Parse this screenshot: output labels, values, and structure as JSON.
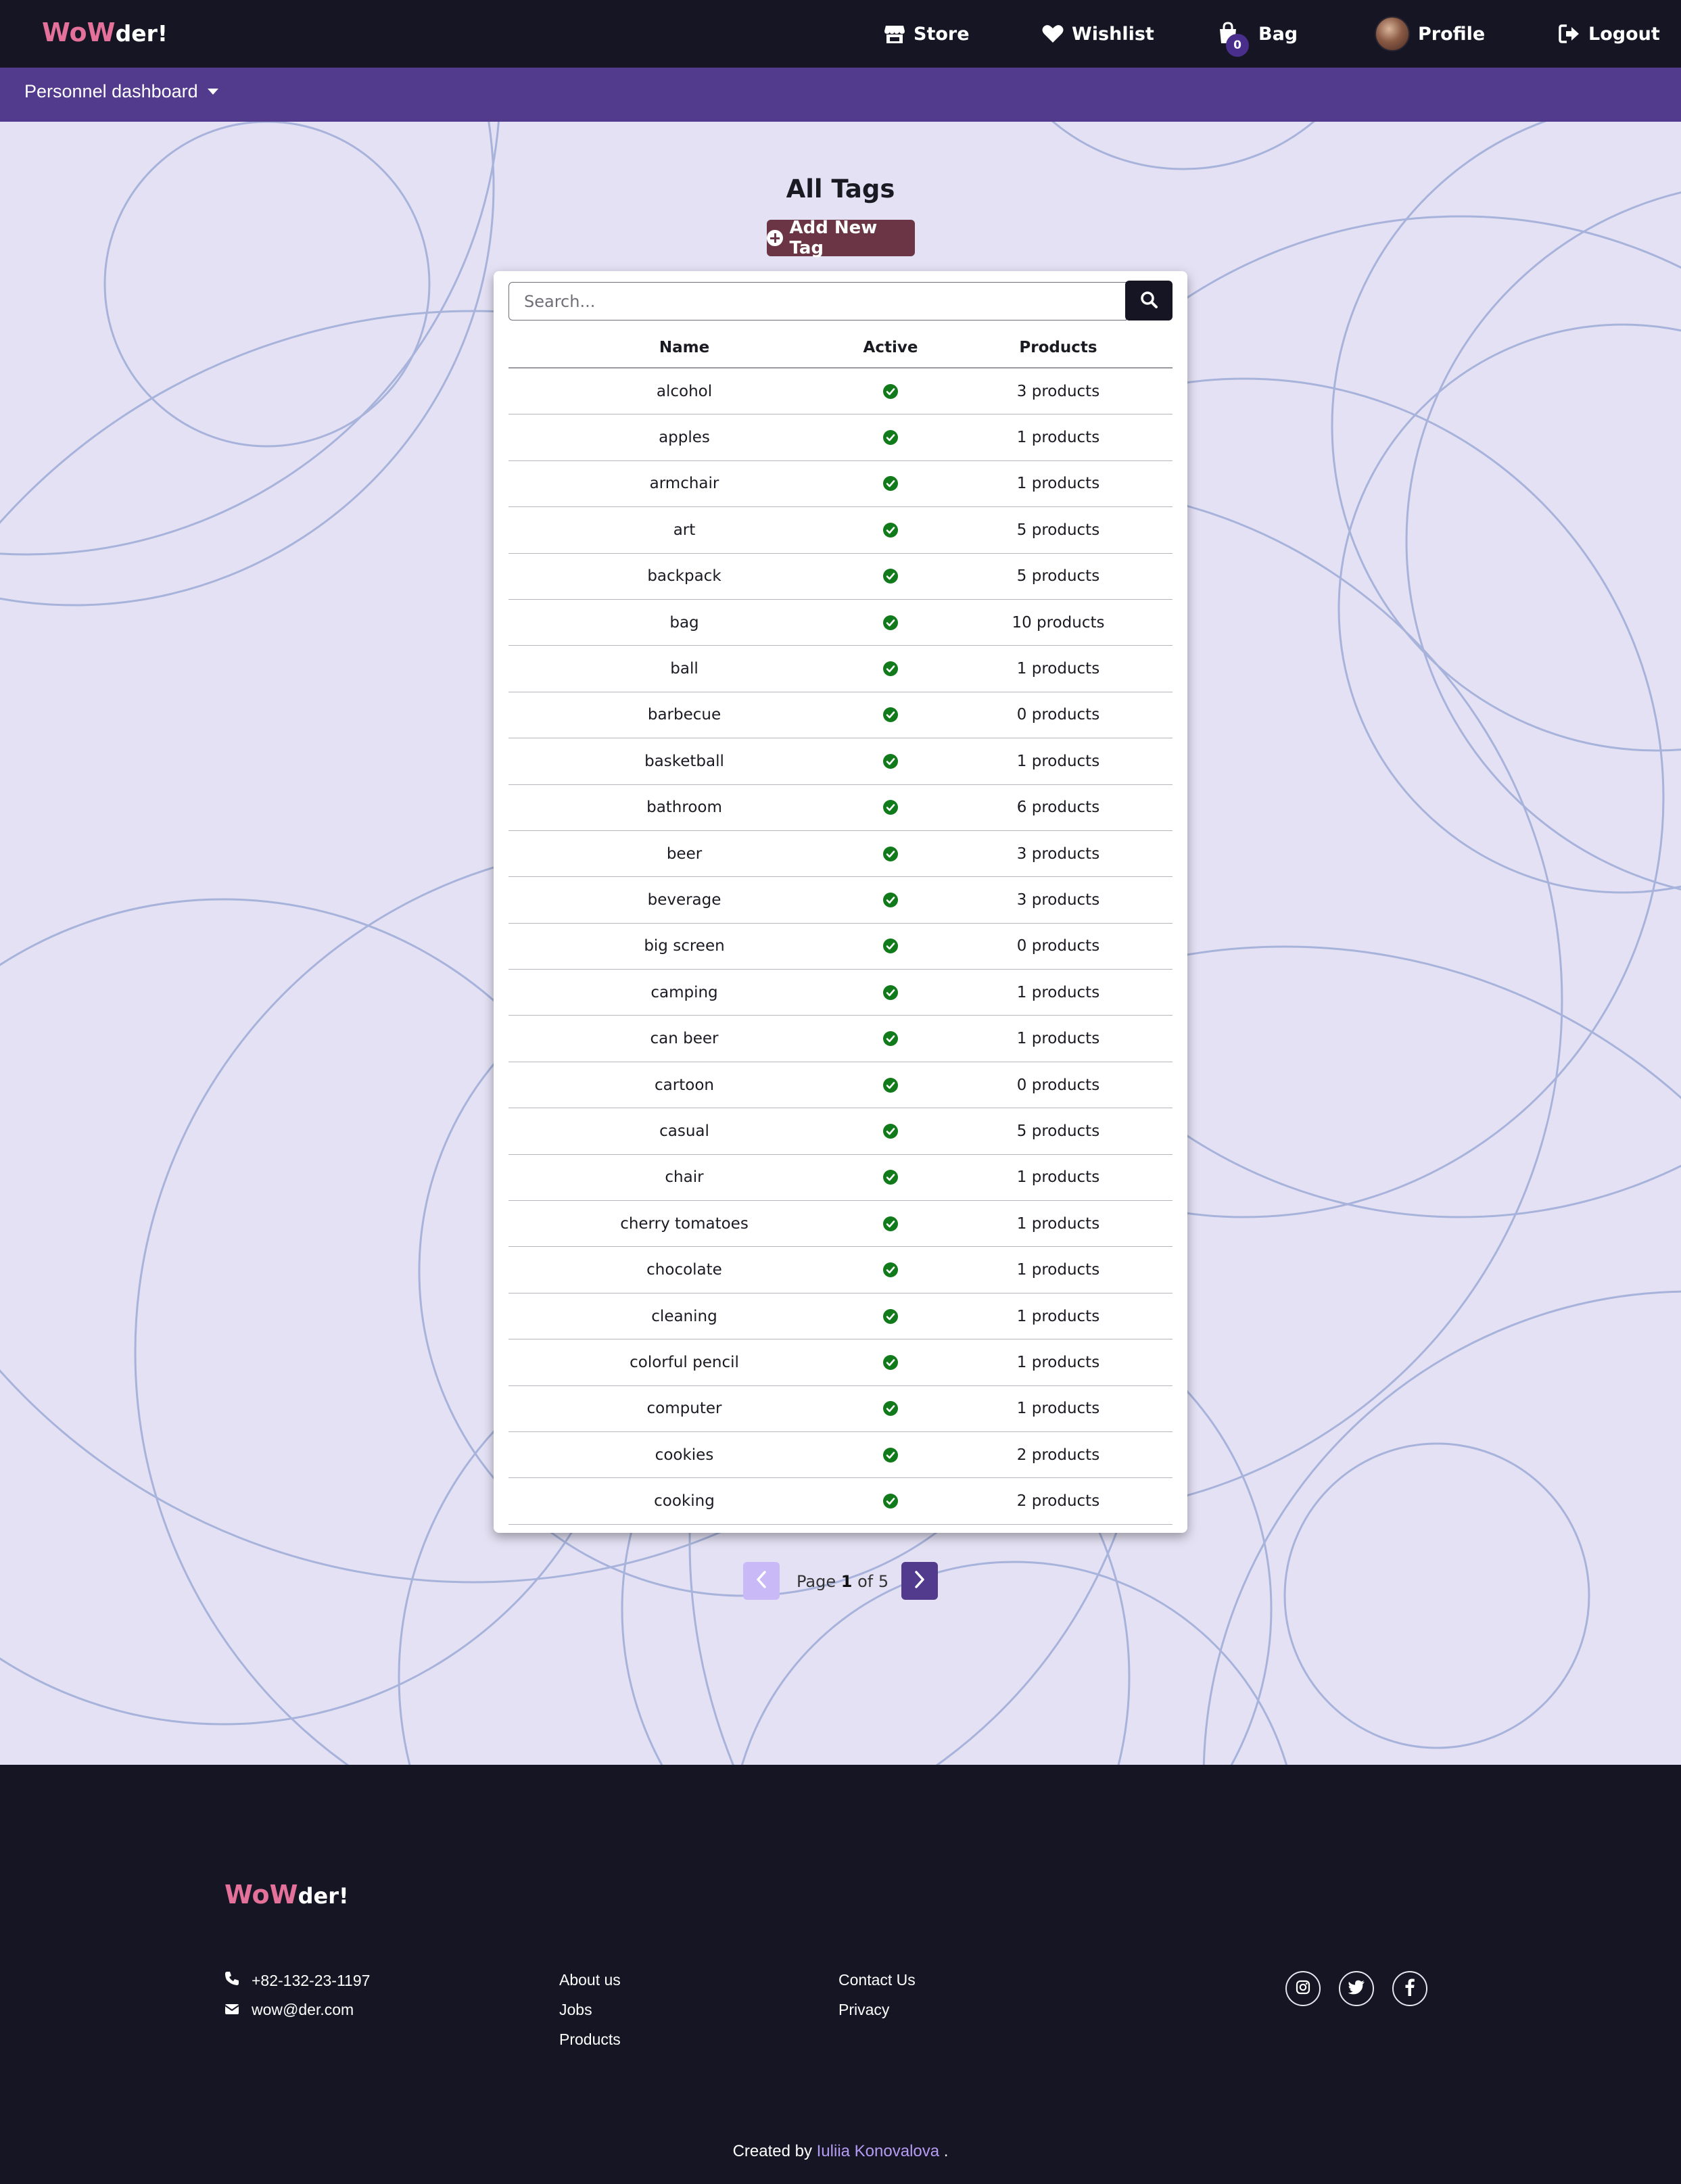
{
  "brand": {
    "part1": "WoW",
    "part2": "der!"
  },
  "nav": {
    "store": "Store",
    "wishlist": "Wishlist",
    "bag": "Bag",
    "bag_count": "0",
    "profile": "Profile",
    "logout": "Logout"
  },
  "subnav": {
    "dashboard_label": "Personnel dashboard"
  },
  "main": {
    "title": "All Tags",
    "add_button": "Add New Tag",
    "search_placeholder": "Search...",
    "table": {
      "headers": {
        "name": "Name",
        "active": "Active",
        "products": "Products"
      },
      "rows": [
        {
          "name": "alcohol",
          "active": true,
          "products": "3 products"
        },
        {
          "name": "apples",
          "active": true,
          "products": "1 products"
        },
        {
          "name": "armchair",
          "active": true,
          "products": "1 products"
        },
        {
          "name": "art",
          "active": true,
          "products": "5 products"
        },
        {
          "name": "backpack",
          "active": true,
          "products": "5 products"
        },
        {
          "name": "bag",
          "active": true,
          "products": "10 products"
        },
        {
          "name": "ball",
          "active": true,
          "products": "1 products"
        },
        {
          "name": "barbecue",
          "active": true,
          "products": "0 products"
        },
        {
          "name": "basketball",
          "active": true,
          "products": "1 products"
        },
        {
          "name": "bathroom",
          "active": true,
          "products": "6 products"
        },
        {
          "name": "beer",
          "active": true,
          "products": "3 products"
        },
        {
          "name": "beverage",
          "active": true,
          "products": "3 products"
        },
        {
          "name": "big screen",
          "active": true,
          "products": "0 products"
        },
        {
          "name": "camping",
          "active": true,
          "products": "1 products"
        },
        {
          "name": "can beer",
          "active": true,
          "products": "1 products"
        },
        {
          "name": "cartoon",
          "active": true,
          "products": "0 products"
        },
        {
          "name": "casual",
          "active": true,
          "products": "5 products"
        },
        {
          "name": "chair",
          "active": true,
          "products": "1 products"
        },
        {
          "name": "cherry tomatoes",
          "active": true,
          "products": "1 products"
        },
        {
          "name": "chocolate",
          "active": true,
          "products": "1 products"
        },
        {
          "name": "cleaning",
          "active": true,
          "products": "1 products"
        },
        {
          "name": "colorful pencil",
          "active": true,
          "products": "1 products"
        },
        {
          "name": "computer",
          "active": true,
          "products": "1 products"
        },
        {
          "name": "cookies",
          "active": true,
          "products": "2 products"
        },
        {
          "name": "cooking",
          "active": true,
          "products": "2 products"
        }
      ]
    },
    "pagination": {
      "prefix": "Page ",
      "current": "1",
      "separator": " of ",
      "total": "5"
    }
  },
  "footer": {
    "brand": {
      "part1": "WoW",
      "part2": "der!"
    },
    "phone": "+82-132-23-1197",
    "email": "wow@der.com",
    "links_col1": [
      "About us",
      "Jobs",
      "Products"
    ],
    "links_col2": [
      "Contact Us",
      "Privacy"
    ],
    "social_icons": [
      "instagram-icon",
      "twitter-icon",
      "facebook-icon"
    ],
    "credit_prefix": "Created by ",
    "credit_author": "Iuliia Konovalova",
    "credit_suffix": " ."
  },
  "colors": {
    "navbar": "#161524",
    "subnav": "#523a8d",
    "background": "#e4e1f4",
    "brand_pink": "#e3719a",
    "add_button": "#6b3545",
    "active_check": "#117a1b",
    "pagination_prev": "#c9b9f7",
    "pagination_next": "#523a8d",
    "footer_link": "#b59cf2"
  }
}
